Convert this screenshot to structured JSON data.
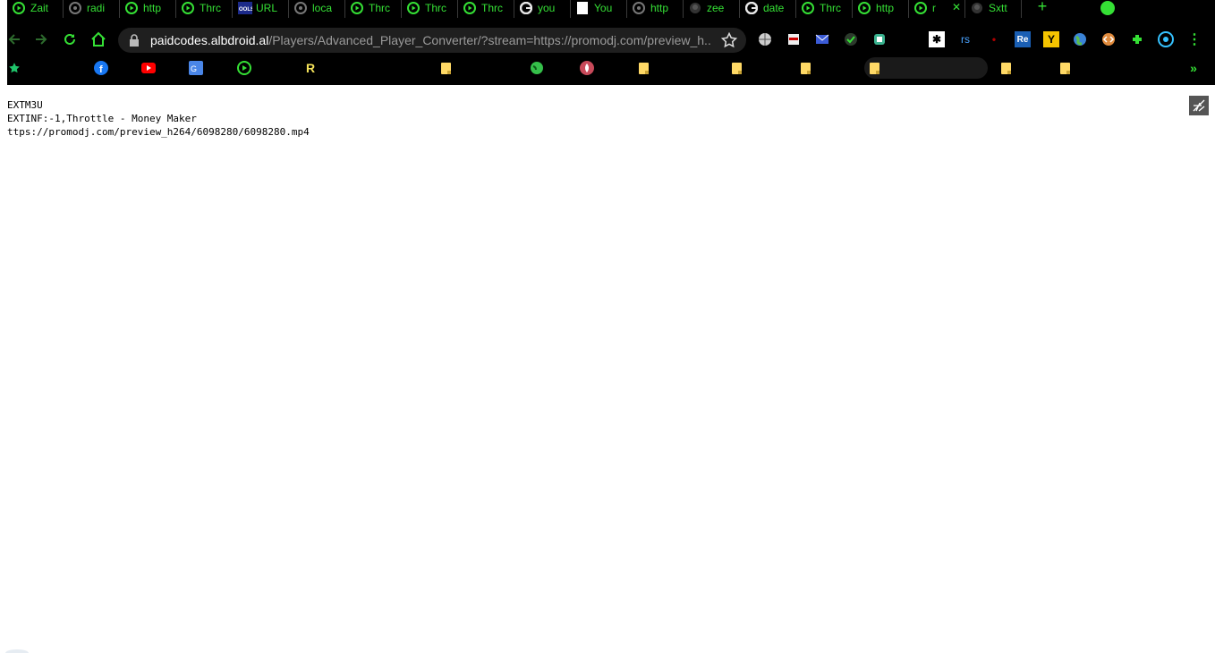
{
  "browser": {
    "tabs": [
      {
        "label": "Zait",
        "icon": "play-circle-icon"
      },
      {
        "label": "radi",
        "icon": "globe-gray-icon"
      },
      {
        "label": "http",
        "icon": "play-circle-icon"
      },
      {
        "label": "Thrc",
        "icon": "play-circle-icon"
      },
      {
        "label": "URL",
        "icon": "tools-icon"
      },
      {
        "label": "loca",
        "icon": "globe-gray-icon"
      },
      {
        "label": "Thrc",
        "icon": "play-circle-icon"
      },
      {
        "label": "Thrc",
        "icon": "play-circle-icon"
      },
      {
        "label": "Thrc",
        "icon": "play-circle-icon"
      },
      {
        "label": "you",
        "icon": "google-icon"
      },
      {
        "label": "You",
        "icon": "white-page-icon"
      },
      {
        "label": "http",
        "icon": "globe-gray-icon"
      },
      {
        "label": "zee",
        "icon": "github-icon"
      },
      {
        "label": "date",
        "icon": "google-icon"
      },
      {
        "label": "Thrc",
        "icon": "play-circle-icon"
      },
      {
        "label": "http",
        "icon": "play-circle-icon"
      },
      {
        "label": "r",
        "icon": "play-circle-icon",
        "active": true
      },
      {
        "label": "Sxtt",
        "icon": "github-icon"
      }
    ],
    "new_tab_label": "+",
    "address_bar": {
      "host": "paidcodes.albdroid.al",
      "path": "/Players/Advanced_Player_Converter/?stream=https://promodj.com/preview_h..."
    },
    "bookmarks": [
      "star",
      "facebook",
      "youtube",
      "google-translate",
      "play",
      "R",
      "folder",
      "globe",
      "fire",
      "folder",
      "folder",
      "folder",
      "folder",
      "folder",
      "folder"
    ],
    "colors": {
      "chrome_bg": "#000000",
      "accent": "#35e035"
    }
  },
  "page": {
    "lines": [
      "EXTM3U",
      "EXTINF:-1,Throttle - Money Maker",
      "ttps://promodj.com/preview_h264/6098280/6098280.mp4"
    ]
  }
}
